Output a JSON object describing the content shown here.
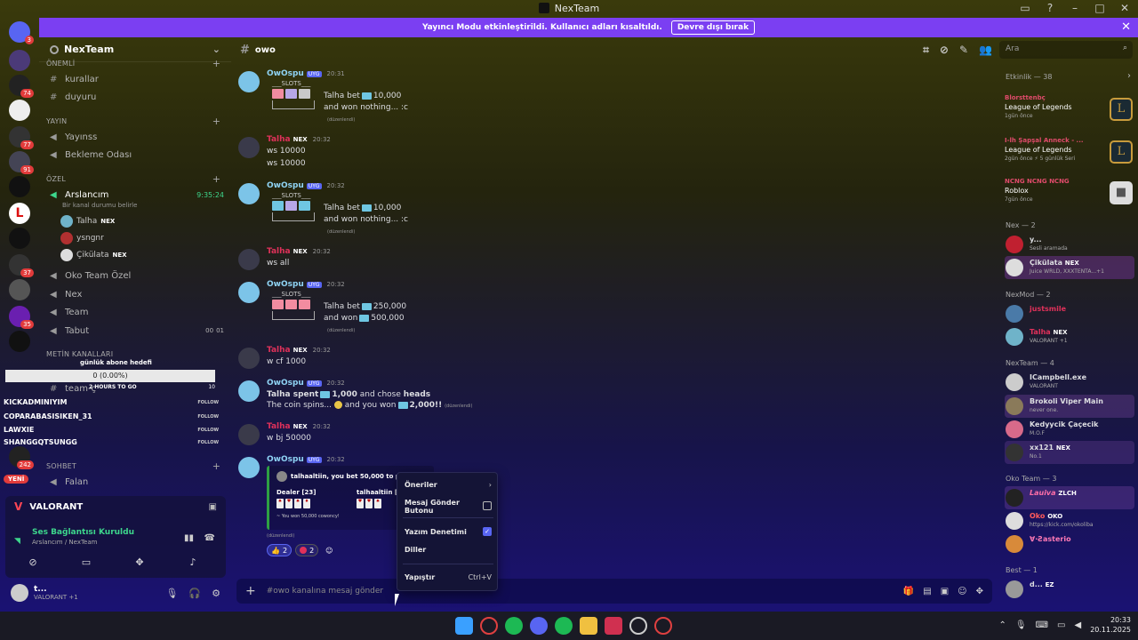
{
  "window": {
    "title": "NexTeam"
  },
  "banner": {
    "text": "Yayıncı Modu etkinleştirildi. Kullanıcı adları kısaltıldı.",
    "button": "Devre dışı bırak"
  },
  "rail": {
    "badges": [
      "3",
      "74",
      "77",
      "91",
      "37",
      "35",
      "242"
    ],
    "new_label": "YENİ"
  },
  "guild": {
    "name": "NexTeam"
  },
  "categories": {
    "important": "ÖNEMLİ",
    "broadcast": "Yayın",
    "private": "ÖZEL",
    "metin": "METİN KANALLARI",
    "chat": "SOHBET"
  },
  "channels": {
    "kurallar": "kurallar",
    "duyuru": "duyuru",
    "yayinss": "Yayınss",
    "bekleme": "Bekleme Odası",
    "arslancim": "Arslancım",
    "arslancim_time": "9:35:24",
    "arslancim_status": "Bir kanal durumu belirle",
    "oko": "Oko Team Özel",
    "nex": "Nex",
    "team": "Team",
    "tabut": "Tabut",
    "tabut_a": "00",
    "tabut_b": "01",
    "teamc": "team-ç",
    "falan": "Falan"
  },
  "voice_users": [
    {
      "name": "Talha",
      "badge": "NEX"
    },
    {
      "name": "ysngnr",
      "badge": ""
    },
    {
      "name": "Çikülata",
      "badge": "NEX"
    }
  ],
  "widget": {
    "title": "günlük abone hedefi",
    "progress": "0 (0.00%)",
    "hours": "2 HOURS TO GO",
    "goal": "10",
    "rows": [
      {
        "name": "KICKADMINIYIM",
        "action": "FOLLOW"
      },
      {
        "name": "COPARABASISIKEN_31",
        "action": "FOLLOW"
      },
      {
        "name": "LAWXIE",
        "action": "FOLLOW"
      },
      {
        "name": "SHANGGQTSUNGG",
        "action": "FOLLOW"
      }
    ]
  },
  "voice_panel": {
    "activity": "VALORANT",
    "connection": "Ses Bağlantısı Kuruldu",
    "location": "Arslancım / NexTeam"
  },
  "user_panel": {
    "name": "t...",
    "status": "VALORANT +1"
  },
  "chat": {
    "channel": "owo",
    "placeholder": "#owo kanalına mesaj gönder",
    "search": "Ara",
    "messages": [
      {
        "author": "OwOspu",
        "tag": "UYG",
        "time": "20:31",
        "slots_label": "___SLOTS___",
        "line1": "Talha bet",
        "amount1": "10,000",
        "line2": "and won nothing... :c",
        "edited": "(düzenlendi)"
      },
      {
        "author": "Talha",
        "tag": "NEX",
        "time": "20:32",
        "lines": [
          "ws 10000",
          "ws 10000"
        ]
      },
      {
        "author": "OwOspu",
        "tag": "UYG",
        "time": "20:32",
        "slots_label": "___SLOTS___",
        "line1": "Talha bet",
        "amount1": "10,000",
        "line2": "and won nothing... :c",
        "edited": "(düzenlendi)"
      },
      {
        "author": "Talha",
        "tag": "NEX",
        "time": "20:32",
        "lines": [
          "ws all"
        ]
      },
      {
        "author": "OwOspu",
        "tag": "UYG",
        "time": "20:32",
        "slots_label": "___SLOTS___",
        "line1": "Talha bet",
        "amount1": "250,000",
        "line2": "and won",
        "amount2": "500,000",
        "edited": "(düzenlendi)"
      },
      {
        "author": "Talha",
        "tag": "NEX",
        "time": "20:32",
        "lines": [
          "w cf 1000"
        ]
      },
      {
        "author": "OwOspu",
        "tag": "UYG",
        "time": "20:32",
        "cf1": "Talha spent",
        "cf_amt": "1,000",
        "cf2": "and chose",
        "cf3": "heads",
        "cf4": "The coin spins...",
        "cf5": "and you won",
        "cf_win": "2,000!!",
        "edited": "(düzenlendi)"
      },
      {
        "author": "Talha",
        "tag": "NEX",
        "time": "20:32",
        "lines": [
          "w bj 50000"
        ]
      },
      {
        "author": "OwOspu",
        "tag": "UYG",
        "time": "20:32",
        "bj_title": "talhaaltiin, you bet 50,000 to play",
        "dealer": "Dealer [23]",
        "player": "talhaaltiin [1",
        "bj_foot": "~ You won 50,000 cowoncy!",
        "edited": "(düzenlendi)",
        "reactions": [
          "2",
          "2"
        ]
      }
    ]
  },
  "context_menu": {
    "items": [
      {
        "label": "Öneriler",
        "right": "›"
      },
      {
        "label": "Mesaj Gönder Butonu",
        "right": ""
      },
      {
        "label": "Yazım Denetimi",
        "right": "✓"
      },
      {
        "label": "Diller",
        "right": ""
      },
      {
        "label": "Yapıştır",
        "right": "Ctrl+V"
      }
    ]
  },
  "members": {
    "activity_title": "Etkinlik — 38",
    "activities": [
      {
        "name": "Blorsttenbç",
        "game": "League of Legends",
        "time": "1gün önce",
        "icon": "L"
      },
      {
        "name": "I-lh Şapşal Anneck - ...",
        "game": "League of Legends",
        "time": "2gün önce  ⚡ 5 günlük Seri",
        "icon": "L"
      },
      {
        "name": "NCNG NCNG NCNG",
        "game": "Roblox",
        "time": "7gün önce",
        "icon": "■"
      }
    ],
    "sections": [
      {
        "title": "Nex — 2",
        "users": [
          {
            "name": "y...",
            "status": "Sesli aramada",
            "color": "#ffffff"
          },
          {
            "name": "Çikülata",
            "status": "Juice WRLD, XXXTENTA...+1",
            "color": "#ffffff",
            "badge": "NEX"
          }
        ]
      },
      {
        "title": "NexMod — 2",
        "users": [
          {
            "name": "justsmile",
            "status": "",
            "color": "#e0315a"
          },
          {
            "name": "Talha",
            "status": "VALORANT +1",
            "color": "#e0315a",
            "badge": "NEX"
          }
        ]
      },
      {
        "title": "NexTeam — 4",
        "users": [
          {
            "name": "ICampbell.exe",
            "status": "VALORANT",
            "color": "#ffffff"
          },
          {
            "name": "Brokoli Viper Main",
            "status": "never one.",
            "color": "#ffffff"
          },
          {
            "name": "Kedyycik Çaçecik",
            "status": "M.O.F",
            "color": "#ffffff"
          },
          {
            "name": "xx121",
            "status": "No.1",
            "color": "#ffffff",
            "badge": "NEX"
          }
        ]
      },
      {
        "title": "Oko Team — 3",
        "users": [
          {
            "name": "Lauiva",
            "status": "",
            "color": "#ff6fa8",
            "badge": "ZLCH"
          },
          {
            "name": "Oko",
            "status": "https://kick.com/okoliba",
            "color": "#ff5a5a",
            "badge": "OKO"
          },
          {
            "name": "∀·Ƨasterio",
            "status": "",
            "color": "#ff7ab6"
          }
        ]
      },
      {
        "title": "Best — 1",
        "users": [
          {
            "name": "d...",
            "status": "",
            "color": "#ffffff",
            "badge": "EZ"
          }
        ]
      }
    ]
  },
  "taskbar": {
    "time": "20:33",
    "date": "20.11.2025"
  },
  "colors": {
    "accent": "#5865f2",
    "banner": "#7b3ff2",
    "online": "#3dd68c",
    "mod": "#e0315a"
  }
}
